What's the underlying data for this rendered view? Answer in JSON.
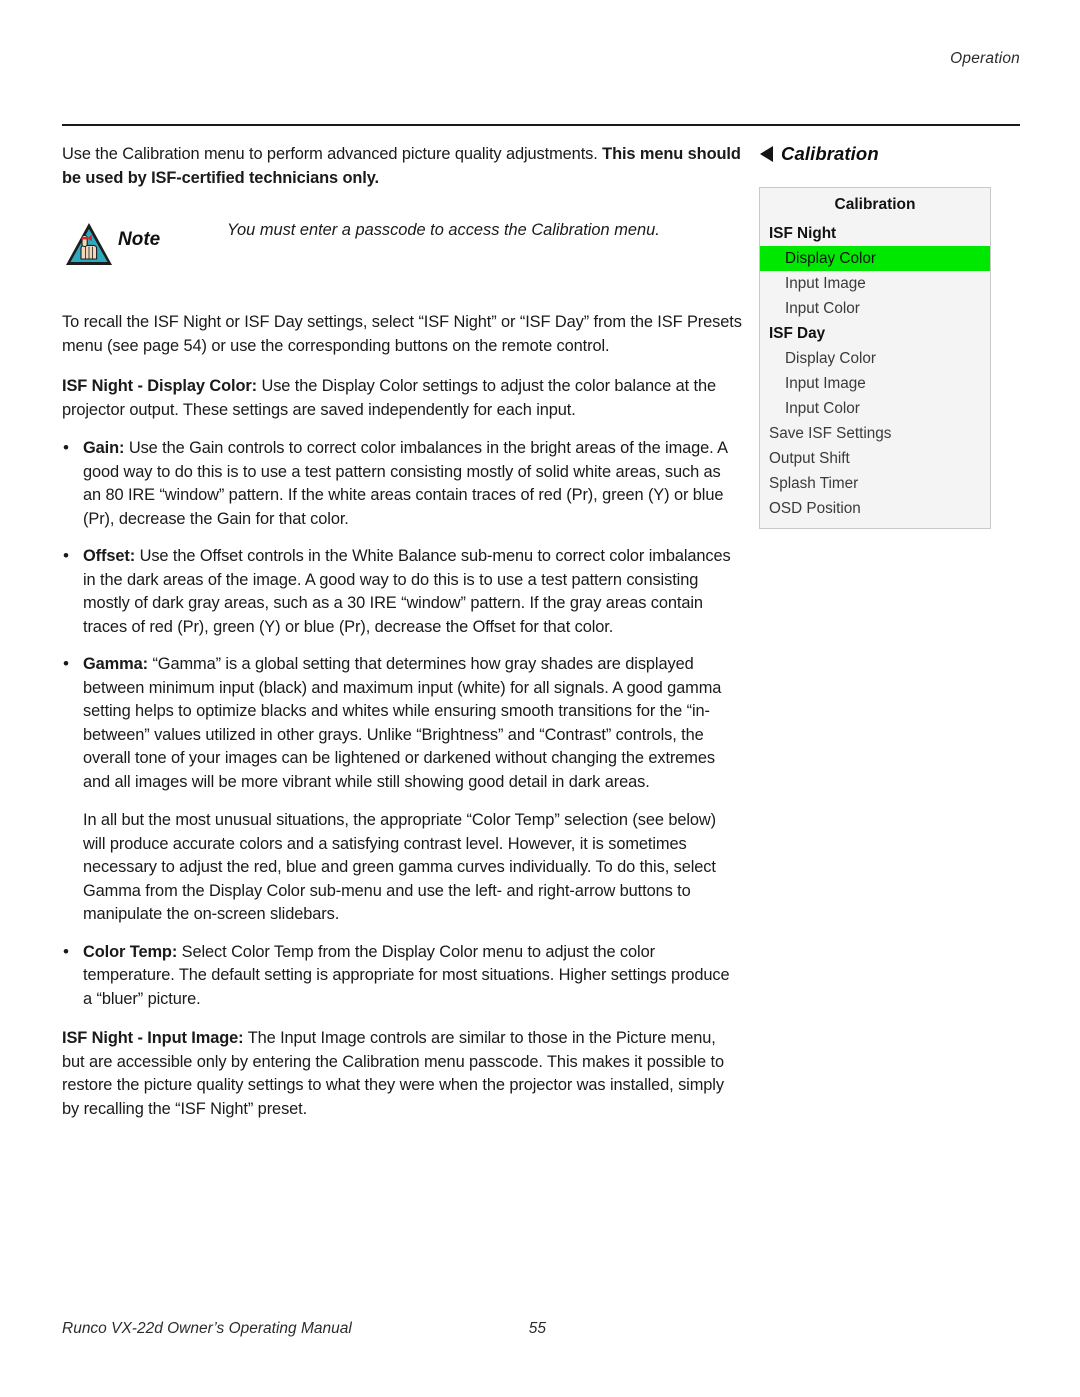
{
  "header": {
    "running_head": "Operation"
  },
  "body": {
    "intro": {
      "plain_1": "Use the Calibration menu to perform advanced picture quality adjustments. ",
      "bold_1": "This menu should be used by ISF-certified technicians only."
    },
    "note": {
      "label": "Note",
      "icon": "note-hand-triangle-icon",
      "text": "You must enter a passcode to access the Calibration menu."
    },
    "recall_para": "To recall the ISF Night or ISF Day settings, select “ISF Night” or “ISF Day” from the ISF Presets menu (see page 54) or use the corresponding buttons on the remote control.",
    "display_color": {
      "bold_lead": "ISF Night - Display Color:",
      "rest": " Use the Display Color settings to adjust the color balance at the projector output. These settings are saved independently for each input."
    },
    "bullets": [
      {
        "bold_lead": "Gain:",
        "rest": " Use the Gain controls to correct color imbalances in the bright areas of the image. A good way to do this is to use a test pattern consisting mostly of solid white areas, such as an 80 IRE “window” pattern. If the white areas contain traces of red (Pr), green (Y) or blue (Pr), decrease the Gain for that color.",
        "sub": ""
      },
      {
        "bold_lead": "Offset:",
        "rest": " Use the Offset controls in the White Balance sub-menu to correct color imbalances in the dark areas of the image. A good way to do this is to use a test pattern consisting mostly of dark gray areas, such as a 30 IRE “window” pattern. If the gray areas contain traces of red (Pr), green (Y) or blue (Pr), decrease the Offset for that color.",
        "sub": ""
      },
      {
        "bold_lead": "Gamma:",
        "rest": " “Gamma” is a global setting that determines how gray shades are displayed between minimum input (black) and maximum input (white) for all signals. A good gamma setting helps to optimize blacks and whites while ensuring smooth transitions for the “in-between” values utilized in other grays. Unlike “Brightness” and “Contrast” controls, the overall tone of your images can be lightened or darkened without changing the extremes and all images will be more vibrant while still showing good detail in dark areas.",
        "sub": "In all but the most unusual situations, the appropriate “Color Temp” selection (see below) will produce accurate colors and a satisfying contrast level. However, it is sometimes necessary to adjust the red, blue and green gamma curves individually. To do this, select Gamma from the Display Color sub-menu and use the left- and right-arrow buttons to manipulate the on-screen slidebars."
      },
      {
        "bold_lead": "Color Temp:",
        "rest": " Select Color Temp from the Display Color menu to adjust the color temperature. The default setting is appropriate for most situations. Higher settings produce a “bluer” picture.",
        "sub": ""
      }
    ],
    "input_image": {
      "bold_lead": "ISF Night - Input Image:",
      "rest": " The Input Image controls are similar to those in the Picture menu, but are accessible only by entering the Calibration menu passcode. This makes it possible to restore the picture quality settings to what they were when the projector was installed, simply by recalling the “ISF Night” preset."
    }
  },
  "sidebar": {
    "heading": "Calibration",
    "arrow_icon": "left-triangle-icon",
    "osd": {
      "title": "Calibration",
      "highlight_color": "#00e800",
      "background_color": "#f4f4f4",
      "border_color": "#c9c9c9",
      "items": [
        {
          "label": "ISF Night",
          "level": "group",
          "selected": false
        },
        {
          "label": "Display Color",
          "level": "child",
          "selected": true
        },
        {
          "label": "Input Image",
          "level": "child",
          "selected": false
        },
        {
          "label": "Input Color",
          "level": "child",
          "selected": false
        },
        {
          "label": "ISF Day",
          "level": "group",
          "selected": false
        },
        {
          "label": "Display Color",
          "level": "child",
          "selected": false
        },
        {
          "label": "Input Image",
          "level": "child",
          "selected": false
        },
        {
          "label": "Input Color",
          "level": "child",
          "selected": false
        },
        {
          "label": "Save ISF Settings",
          "level": "top",
          "selected": false
        },
        {
          "label": "Output Shift",
          "level": "top",
          "selected": false
        },
        {
          "label": "Splash Timer",
          "level": "top",
          "selected": false
        },
        {
          "label": "OSD Position",
          "level": "top",
          "selected": false
        }
      ]
    }
  },
  "footer": {
    "doc_title": "Runco VX-22d Owner’s Operating Manual",
    "page_number": "55"
  }
}
